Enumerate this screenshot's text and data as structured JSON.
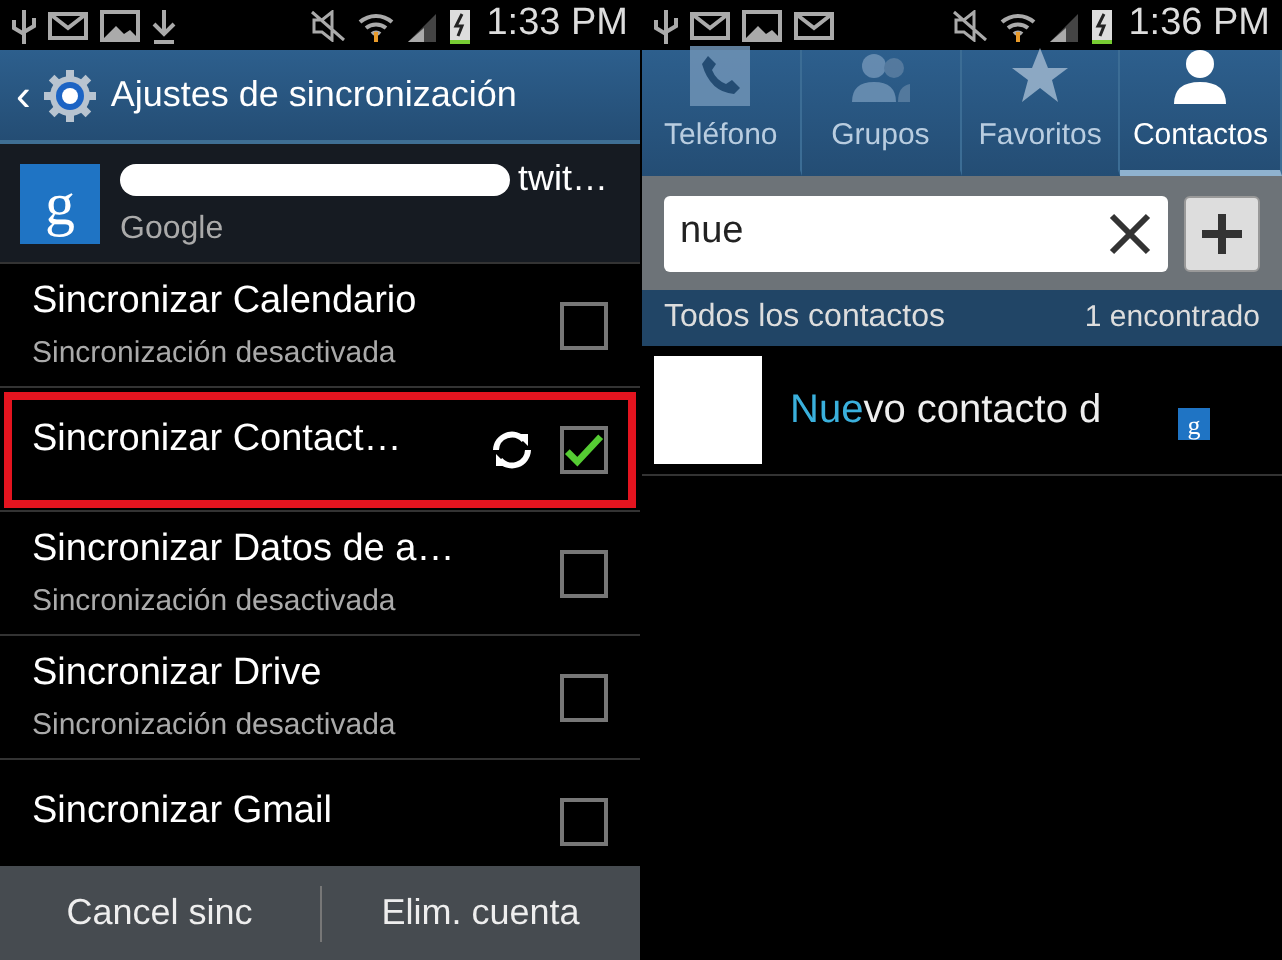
{
  "left": {
    "status_bar": {
      "time": "1:33 PM"
    },
    "action_bar": {
      "back": "‹",
      "title": "Ajustes de sincronización"
    },
    "account": {
      "logo": "g",
      "name": "twit…",
      "type": "Google"
    },
    "sync_items": [
      {
        "title": "Sincronizar Calendario",
        "subtitle": "Sincronización desactivada",
        "checked": false,
        "syncing": false,
        "highlighted": false
      },
      {
        "title": "Sincronizar Contact…",
        "checked": true,
        "syncing": true,
        "highlighted": true
      },
      {
        "title": "Sincronizar Datos de a…",
        "subtitle": "Sincronización desactivada",
        "checked": false,
        "syncing": false,
        "highlighted": false
      },
      {
        "title": "Sincronizar Drive",
        "subtitle": "Sincronización desactivada",
        "checked": false,
        "syncing": false,
        "highlighted": false
      },
      {
        "title": "Sincronizar Gmail",
        "checked": false,
        "syncing": false,
        "highlighted": false
      }
    ],
    "bottom_buttons": [
      "Cancel sinc",
      "Elim. cuenta"
    ]
  },
  "right": {
    "status_bar": {
      "time": "1:36 PM"
    },
    "tabs": [
      {
        "label": "Teléfono",
        "kind": "phone",
        "selected": false
      },
      {
        "label": "Grupos",
        "kind": "group",
        "selected": false
      },
      {
        "label": "Favoritos",
        "kind": "star",
        "selected": false
      },
      {
        "label": "Contactos",
        "kind": "person",
        "selected": true
      }
    ],
    "search": {
      "value": "nue"
    },
    "section": {
      "title": "Todos los contactos",
      "count": "1 encontrado"
    },
    "contacts": [
      {
        "match": "Nue",
        "rest": "vo contacto d",
        "source_logo": "g"
      }
    ]
  }
}
